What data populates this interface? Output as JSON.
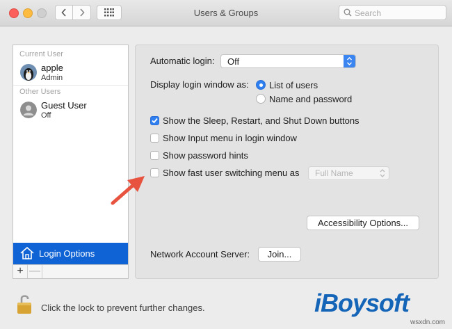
{
  "window": {
    "title": "Users & Groups"
  },
  "search": {
    "placeholder": "Search"
  },
  "sidebar": {
    "current_user_label": "Current User",
    "current_user": {
      "name": "apple",
      "role": "Admin"
    },
    "other_users_label": "Other Users",
    "other_users": [
      {
        "name": "Guest User",
        "role": "Off"
      }
    ],
    "login_options_label": "Login Options",
    "add_symbol": "+",
    "remove_symbol": "—"
  },
  "panel": {
    "automatic_login_label": "Automatic login:",
    "automatic_login_value": "Off",
    "display_login_label": "Display login window as:",
    "display_options": [
      {
        "label": "List of users",
        "selected": true
      },
      {
        "label": "Name and password",
        "selected": false
      }
    ],
    "checkboxes": [
      {
        "label": "Show the Sleep, Restart, and Shut Down buttons",
        "checked": true
      },
      {
        "label": "Show Input menu in login window",
        "checked": false
      },
      {
        "label": "Show password hints",
        "checked": false
      },
      {
        "label": "Show fast user switching menu as",
        "checked": false
      }
    ],
    "fast_switch_value": "Full Name",
    "accessibility_button": "Accessibility Options...",
    "network_server_label": "Network Account Server:",
    "join_button": "Join..."
  },
  "footer": {
    "lock_text": "Click the lock to prevent further changes."
  },
  "branding": {
    "logo": "iBoysoft",
    "watermark": "wsxdn.com"
  },
  "colors": {
    "accent": "#2f7ff1",
    "selection": "#0f63d4",
    "arrow": "#e8533f",
    "brand": "#1464b8"
  }
}
